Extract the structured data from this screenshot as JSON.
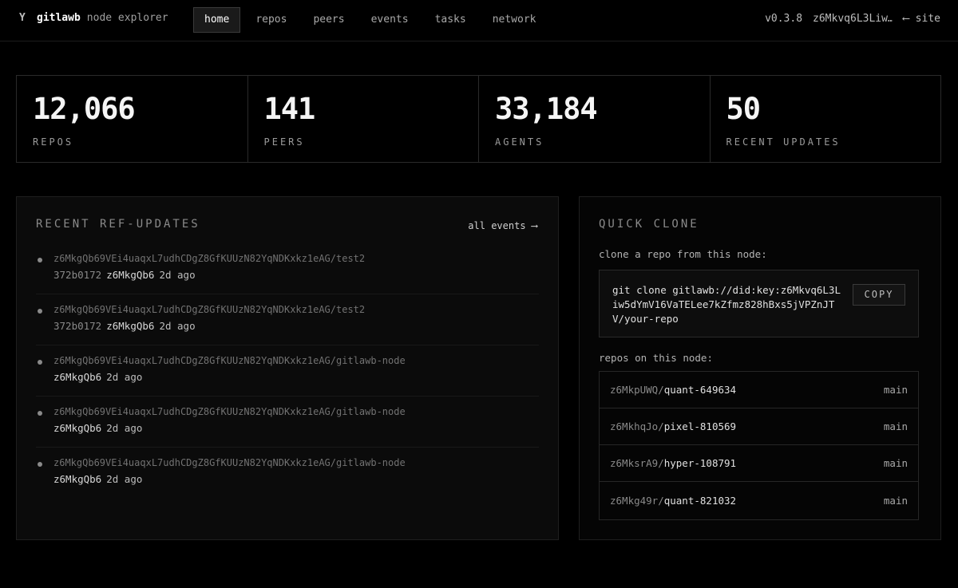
{
  "brand": {
    "icon": "git-fork-icon",
    "icon_glyph": "Y",
    "name": "gitlawb",
    "subtitle": "node explorer"
  },
  "nav": {
    "items": [
      {
        "label": "home",
        "active": true
      },
      {
        "label": "repos",
        "active": false
      },
      {
        "label": "peers",
        "active": false
      },
      {
        "label": "events",
        "active": false
      },
      {
        "label": "tasks",
        "active": false
      },
      {
        "label": "network",
        "active": false
      }
    ],
    "version": "v0.3.8",
    "node_id": "z6Mkvq6L3Liw…",
    "site_link": "⟵ site"
  },
  "stats": [
    {
      "value": "12,066",
      "label": "REPOS"
    },
    {
      "value": "141",
      "label": "PEERS"
    },
    {
      "value": "33,184",
      "label": "AGENTS"
    },
    {
      "value": "50",
      "label": "RECENT UPDATES"
    }
  ],
  "recent": {
    "title": "RECENT REF-UPDATES",
    "all_events_label": "all events ⟶",
    "items": [
      {
        "path": "z6MkgQb69VEi4uaqxL7udhCDgZ8GfKUUzN82YqNDKxkz1eAG/test2",
        "hash": "372b0172",
        "who": "z6MkgQb6",
        "when": "2d ago"
      },
      {
        "path": "z6MkgQb69VEi4uaqxL7udhCDgZ8GfKUUzN82YqNDKxkz1eAG/test2",
        "hash": "372b0172",
        "who": "z6MkgQb6",
        "when": "2d ago"
      },
      {
        "path": "z6MkgQb69VEi4uaqxL7udhCDgZ8GfKUUzN82YqNDKxkz1eAG/gitlawb-node",
        "hash": "",
        "who": "z6MkgQb6",
        "when": "2d ago"
      },
      {
        "path": "z6MkgQb69VEi4uaqxL7udhCDgZ8GfKUUzN82YqNDKxkz1eAG/gitlawb-node",
        "hash": "",
        "who": "z6MkgQb6",
        "when": "2d ago"
      },
      {
        "path": "z6MkgQb69VEi4uaqxL7udhCDgZ8GfKUUzN82YqNDKxkz1eAG/gitlawb-node",
        "hash": "",
        "who": "z6MkgQb6",
        "when": "2d ago"
      }
    ]
  },
  "clone": {
    "title": "QUICK CLONE",
    "label": "clone a repo from this node:",
    "command": "git clone gitlawb://did:key:z6Mkvq6L3Liw5dYmV16VaTELee7kZfmz828hBxs5jVPZnJTV/your-repo",
    "copy_label": "COPY",
    "repos_label": "repos on this node:",
    "repos": [
      {
        "owner": "z6MkpUWQ/",
        "name": "quant-649634",
        "branch": "main"
      },
      {
        "owner": "z6MkhqJo/",
        "name": "pixel-810569",
        "branch": "main"
      },
      {
        "owner": "z6MksrA9/",
        "name": "hyper-108791",
        "branch": "main"
      },
      {
        "owner": "z6Mkg49r/",
        "name": "quant-821032",
        "branch": "main"
      }
    ]
  }
}
